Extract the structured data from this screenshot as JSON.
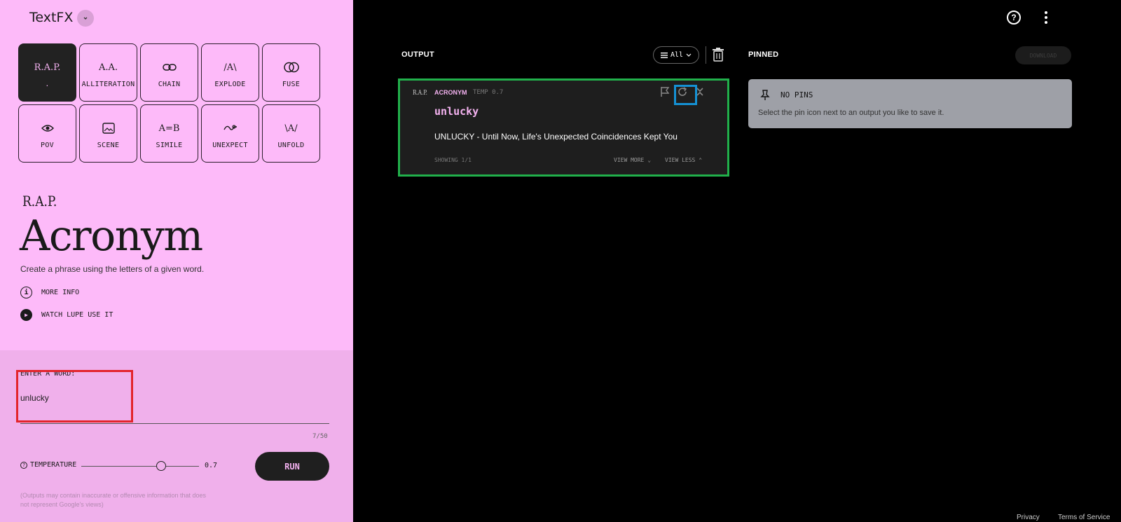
{
  "app": {
    "title": "TextFX"
  },
  "tools": [
    {
      "label": ".",
      "icon_text": "R.A.P.",
      "active": true
    },
    {
      "label": "ALLITERATION",
      "icon_text": "A.A."
    },
    {
      "label": "CHAIN",
      "icon_text": "⛓"
    },
    {
      "label": "EXPLODE",
      "icon_text": "/A\\"
    },
    {
      "label": "FUSE",
      "icon_text": "◐◑"
    },
    {
      "label": "POV",
      "icon_text": "◉"
    },
    {
      "label": "SCENE",
      "icon_text": "▣"
    },
    {
      "label": "SIMILE",
      "icon_text": "A=B"
    },
    {
      "label": "UNEXPECT",
      "icon_text": "∿"
    },
    {
      "label": "UNFOLD",
      "icon_text": "\\A/"
    }
  ],
  "tool_info": {
    "tag": "R.A.P.",
    "name": "Acronym",
    "description": "Create a phrase using the letters of a given word.",
    "more_info": "MORE INFO",
    "watch": "WATCH LUPE USE IT"
  },
  "input": {
    "label": "ENTER A WORD:",
    "value": "unlucky",
    "counter": "7/50"
  },
  "temperature": {
    "label": "TEMPERATURE",
    "value": "0.7",
    "level_fraction": 0.7
  },
  "run_label": "RUN",
  "disclaimer": "(Outputs may contain inaccurate or offensive information that does not represent Google's views)",
  "output": {
    "title": "OUTPUT",
    "filter_label": "All",
    "card": {
      "tag": "R.A.P.",
      "type": "ACRONYM",
      "temp": "TEMP 0.7",
      "word": "unlucky",
      "result": "UNLUCKY - Until Now, Life's Unexpected Coincidences Kept You",
      "showing": "SHOWING 1/1",
      "view_more": "VIEW MORE",
      "view_less": "VIEW LESS"
    }
  },
  "pinned": {
    "title": "PINNED",
    "download_label": "DOWNLOAD",
    "empty_title": "NO PINS",
    "empty_desc": "Select the pin icon next to an output you like to save it."
  },
  "footer": {
    "privacy": "Privacy",
    "terms": "Terms of Service"
  },
  "colors": {
    "left_bg": "#fdbaf9",
    "accent": "#f4b2f0",
    "right_bg": "#000000",
    "highlight_red": "#e3242b",
    "highlight_green": "#21b04b",
    "highlight_blue": "#1591d4"
  }
}
